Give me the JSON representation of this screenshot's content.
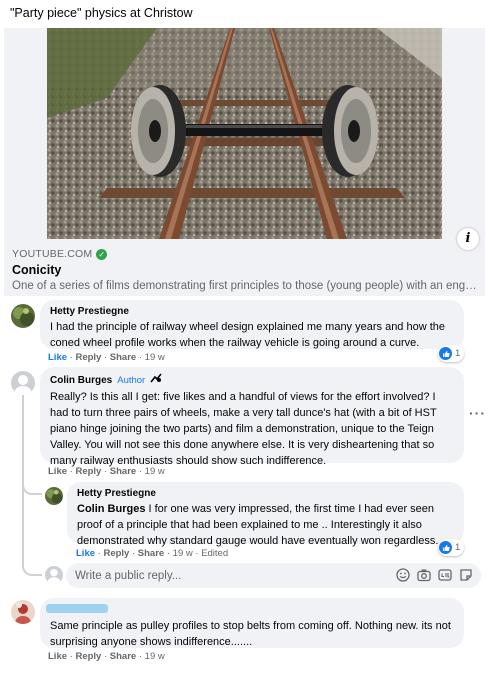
{
  "post": {
    "text": "\"Party piece\" physics at Christow"
  },
  "link_preview": {
    "domain": "YOUTUBE.COM",
    "title": "Conicity",
    "description": "One of a series of films demonstrating first principles to those (young people) with an enginee...",
    "info_icon": "i"
  },
  "comments": [
    {
      "author": "Hetty Prestiegne",
      "text": "I had the principle of railway wheel design explained me many years and how the coned wheel profile works when the railway vehicle is going around a curve.",
      "like_label": "Like",
      "reply_label": "Reply",
      "share_label": "Share",
      "time": "19 w",
      "reactions": "1"
    },
    {
      "author": "Colin Burges",
      "badge": "Author",
      "text": "Really? Is this all I get: five likes and a handful of views for the effort involved? I had to turn three pairs of wheels, make a very tall dunce's hat (with a bit of HST piano hinge joining the two parts) and film a demonstration, unique to the Teign Valley. You will not see this done anywhere else. It is very disheartening that so many railway enthusiasts should show such indifference.",
      "like_label": "Like",
      "reply_label": "Reply",
      "share_label": "Share",
      "time": "19 w",
      "reply": {
        "author": "Hetty Prestiegne",
        "mention": "Colin Burges",
        "text": " I for one was very impressed, the first time I had ever seen proof of a principle that had been explained to me .. Interestingly it also demonstrated why standard gauge would have eventually won regardless.",
        "like_label": "Like",
        "reply_label": "Reply",
        "share_label": "Share",
        "time": "19 w",
        "edited": "Edited",
        "reactions": "1"
      }
    },
    {
      "author": "",
      "text": "Same principle as pulley profiles to stop belts from coming off. Nothing new. its not surprising anyone shows indifference.......",
      "like_label": "Like",
      "reply_label": "Reply",
      "share_label": "Share",
      "time": "19 w"
    }
  ],
  "reply_input": {
    "placeholder": "Write a public reply..."
  },
  "icons": [
    "verified-check-icon",
    "info-icon",
    "like-reaction-icon",
    "more-options-icon",
    "emoji-icon",
    "camera-icon",
    "gif-icon",
    "sticker-icon",
    "top-fan-badge-icon"
  ],
  "colors": {
    "accent": "#1877f2",
    "bubble": "#f0f2f5",
    "muted": "#65676b",
    "verified": "#31a24c"
  }
}
